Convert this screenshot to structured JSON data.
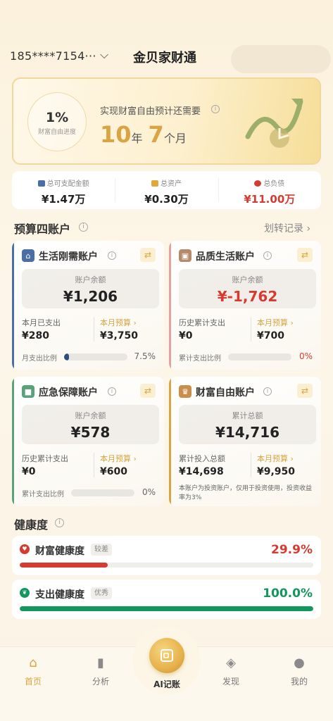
{
  "header": {
    "account": "185****7154···",
    "title": "金贝家财通"
  },
  "hero": {
    "progress_pct": "1%",
    "progress_label": "财富自由进度",
    "text": "实现财富自由预计还需要",
    "years": "10",
    "years_unit": "年",
    "months": "7",
    "months_unit": "个月"
  },
  "summary": [
    {
      "label": "总可支配金额",
      "value": "¥1.47万",
      "color": "#4a6fa5"
    },
    {
      "label": "总资产",
      "value": "¥0.30万",
      "color": "#e0a83a"
    },
    {
      "label": "总负债",
      "value": "¥11.00万",
      "color": "#d53b30"
    }
  ],
  "budget": {
    "title": "预算四账户",
    "transfer": "划转记录 ›"
  },
  "cards": [
    {
      "title": "生活刚需账户",
      "balance_label": "账户余额",
      "balance": "¥1,206",
      "left_label": "本月已支出",
      "left_value": "¥280",
      "right_label": "本月预算 ›",
      "right_value": "¥3,750",
      "ratio_label": "月支出比例",
      "ratio_pct": "7.5%",
      "ratio_fraction": 0.075,
      "accent": "#4a6fa5"
    },
    {
      "title": "品质生活账户",
      "balance_label": "账户余额",
      "balance": "¥-1,762",
      "left_label": "历史累计支出",
      "left_value": "¥0",
      "right_label": "本月预算 ›",
      "right_value": "¥700",
      "ratio_label": "累计支出比例",
      "ratio_pct": "0%",
      "ratio_fraction": 0,
      "accent": "#e3a1a1"
    },
    {
      "title": "应急保障账户",
      "balance_label": "账户余额",
      "balance": "¥578",
      "left_label": "历史累计支出",
      "left_value": "¥0",
      "right_label": "本月预算 ›",
      "right_value": "¥600",
      "ratio_label": "累计支出比例",
      "ratio_pct": "0%",
      "ratio_fraction": 0,
      "accent": "#5aa37a"
    },
    {
      "title": "财富自由账户",
      "balance_label": "累计总额",
      "balance": "¥14,716",
      "left_label": "累计投入总额",
      "left_value": "¥14,698",
      "right_label": "本月预算 ›",
      "right_value": "¥9,950",
      "note": "本账户为投资账户，仅用于投资使用，投资收益率为3%",
      "accent": "#d9a441"
    }
  ],
  "health": {
    "title": "健康度",
    "items": [
      {
        "label": "财富健康度",
        "badge": "较差",
        "pct": "29.9%",
        "fraction": 0.299,
        "color": "#d53b30"
      },
      {
        "label": "支出健康度",
        "badge": "优秀",
        "pct": "100.0%",
        "fraction": 1.0,
        "color": "#14975e"
      }
    ]
  },
  "tabs": {
    "home": "首页",
    "analysis": "分析",
    "ai": "AI记账",
    "discover": "发现",
    "mine": "我的"
  }
}
